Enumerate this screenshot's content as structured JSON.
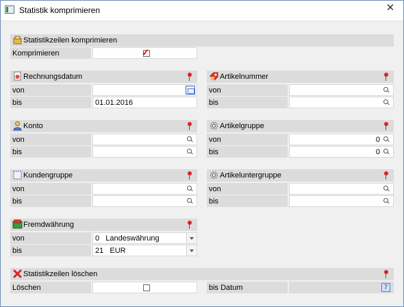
{
  "window": {
    "title": "Statistik komprimieren",
    "close_symbol": "✕"
  },
  "compress": {
    "header": "Statistikzeilen komprimieren",
    "label": "Komprimieren",
    "checked": true
  },
  "rechnungsdatum": {
    "header": "Rechnungsdatum",
    "von_label": "von",
    "bis_label": "bis",
    "von_value": "",
    "bis_value": "01.01.2016"
  },
  "artikelnummer": {
    "header": "Artikelnummer",
    "von_label": "von",
    "bis_label": "bis",
    "von_value": "",
    "bis_value": ""
  },
  "konto": {
    "header": "Konto",
    "von_label": "von",
    "bis_label": "bis",
    "von_value": "",
    "bis_value": ""
  },
  "artikelgruppe": {
    "header": "Artikelgruppe",
    "von_label": "von",
    "bis_label": "bis",
    "von_value": "0",
    "bis_value": "0"
  },
  "kundengruppe": {
    "header": "Kundengruppe",
    "von_label": "von",
    "bis_label": "bis",
    "von_value": "",
    "bis_value": ""
  },
  "artikeluntergruppe": {
    "header": "Artikeluntergruppe",
    "von_label": "von",
    "bis_label": "bis",
    "von_value": "",
    "bis_value": ""
  },
  "fremdwaehrung": {
    "header": "Fremdwährung",
    "von_label": "von",
    "bis_label": "bis",
    "von_value": "0   Landeswährung",
    "bis_value": "21   EUR"
  },
  "loeschen": {
    "header": "Statistikzeilen löschen",
    "label": "Löschen",
    "checked": false,
    "bis_datum_label": "bis Datum",
    "bis_datum_value": "",
    "cal_icon_text": "7"
  }
}
